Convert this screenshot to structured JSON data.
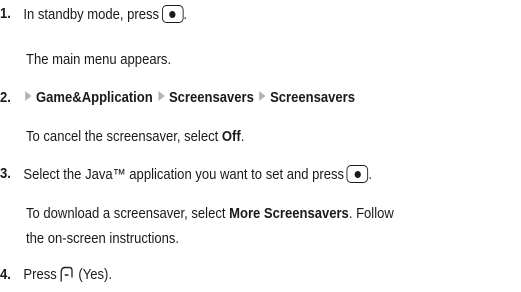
{
  "steps": [
    {
      "number": "1.",
      "text": "In standby mode, press",
      "key_icon": "ok-center-key-icon",
      "after_key": ".",
      "note": "The main menu appears."
    },
    {
      "number": "2.",
      "path": [
        "Game&Application",
        "Screensavers",
        "Screensavers"
      ],
      "note_prefix": "To cancel the screensaver, select ",
      "note_bold": "Off",
      "note_suffix": "."
    },
    {
      "number": "3.",
      "text": "Select the Java™ application you want to set and press",
      "key_icon": "ok-center-key-icon",
      "after_key": ".",
      "note_prefix": "To download a screensaver, select ",
      "note_bold": "More Screensavers",
      "note_suffix": ". Follow",
      "note_line2": "the on-screen instructions."
    },
    {
      "number": "4.",
      "text": "Press",
      "key_icon": "left-soft-key-icon",
      "after_key": "(Yes)."
    }
  ],
  "colors": {
    "text": "#1a1a1a",
    "arrow": "#b3b3b3"
  }
}
